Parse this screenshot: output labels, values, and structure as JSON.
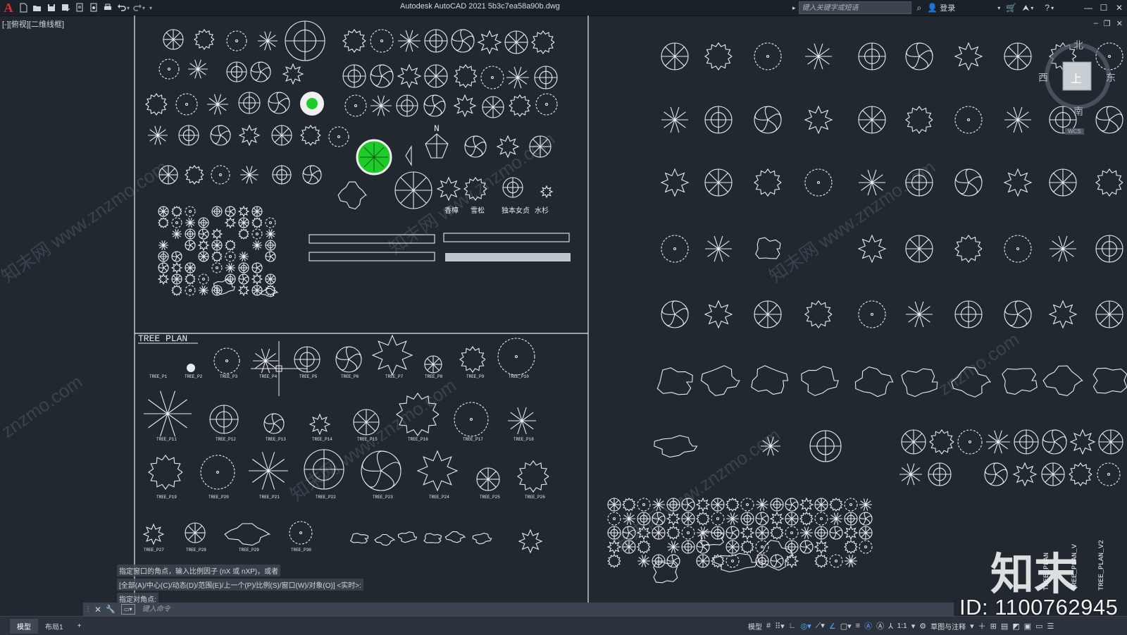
{
  "window": {
    "title": "Autodesk AutoCAD 2021    5b3c7ea58a90b.dwg",
    "viewport_label": "[-][俯视][二维线框]",
    "mdi_controls": [
      "–",
      "❐",
      "✕"
    ],
    "window_controls": [
      "—",
      "☐",
      "✕"
    ]
  },
  "quick_access": {
    "logo": "A",
    "icons": [
      "new-icon",
      "open-icon",
      "save-icon",
      "save-as-icon",
      "publish-icon",
      "plot-preview-icon",
      "print-icon",
      "undo-icon",
      "redo-icon",
      "customize-icon"
    ]
  },
  "search": {
    "placeholder": "键入关键字或短语"
  },
  "account": {
    "login_label": "登录"
  },
  "viewcube": {
    "north": "北",
    "south": "南",
    "east": "东",
    "west": "西",
    "face": "上",
    "wcs": "WCS"
  },
  "drawing": {
    "section_title": "TREE PLAN",
    "north_symbol": "N",
    "labels_top": [
      "香樟",
      "雪松",
      "独本女贞",
      "水杉"
    ],
    "tree_labels": [
      "TREE_P1",
      "TREE_P2",
      "TREE_P3",
      "TREE_P4",
      "TREE_P5",
      "TREE_P6",
      "TREE_P7",
      "TREE_P8",
      "TREE_P9",
      "TREE_P10",
      "TREE_P11",
      "TREE_P12",
      "TREE_P13",
      "TREE_P14",
      "TREE_P15",
      "TREE_P16",
      "TREE_P17",
      "TREE_P18",
      "TREE_P19",
      "TREE_P20",
      "TREE_P21",
      "TREE_P22",
      "TREE_P23",
      "TREE_P24",
      "TREE_P25",
      "TREE_P26",
      "TREE_P27",
      "TREE_P28",
      "TREE_P29",
      "TREE_P30"
    ],
    "vertical_labels": [
      "TREE_PLAN",
      "TREE_PLAN_V",
      "TREE_PLAN_V2"
    ]
  },
  "command": {
    "history": [
      "指定窗口的角点，输入比例因子 (nX 或 nXP)，或者",
      "[全部(A)/中心(C)/动态(D)/范围(E)/上一个(P)/比例(S)/窗口(W)/对象(O)] <实时>:",
      "指定对角点:"
    ],
    "placeholder": "键入命令"
  },
  "status": {
    "tabs": [
      "模型",
      "布局1",
      "+"
    ],
    "model_label": "模型",
    "scale_label": "1:1",
    "workspace_label": "草图与注释"
  },
  "watermarks": {
    "id_text": "ID: 1100762945",
    "brand": "知末"
  },
  "colors": {
    "background": "#212830",
    "highlight_green": "#1ecb2a",
    "linework": "#e8ecf0"
  }
}
